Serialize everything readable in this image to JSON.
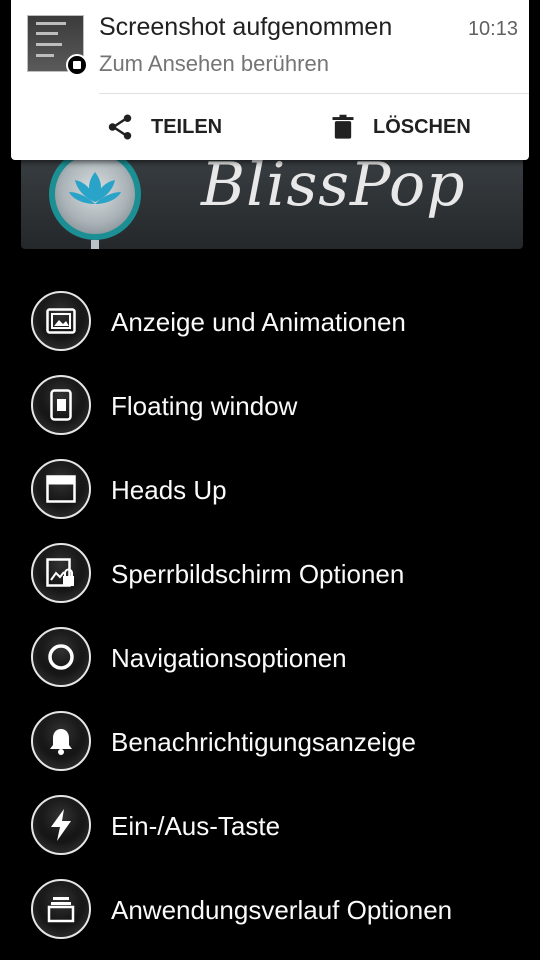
{
  "banner": {
    "brand": "BlissPop"
  },
  "notification": {
    "title": "Screenshot aufgenommen",
    "time": "10:13",
    "subtitle": "Zum Ansehen berühren",
    "actions": {
      "share": "TEILEN",
      "delete": "LÖSCHEN"
    }
  },
  "menu": {
    "items": [
      {
        "label": "Anzeige und Animationen",
        "icon": "display-animation-icon"
      },
      {
        "label": "Floating window",
        "icon": "floating-window-icon"
      },
      {
        "label": "Heads Up",
        "icon": "heads-up-icon"
      },
      {
        "label": "Sperrbildschirm Optionen",
        "icon": "lockscreen-icon"
      },
      {
        "label": "Navigationsoptionen",
        "icon": "navigation-circle-icon"
      },
      {
        "label": "Benachrichtigungsanzeige",
        "icon": "bell-icon"
      },
      {
        "label": "Ein-/Aus-Taste",
        "icon": "power-bolt-icon"
      },
      {
        "label": "Anwendungsverlauf Optionen",
        "icon": "recents-icon"
      }
    ]
  },
  "colors": {
    "accent": "#1b8f94",
    "background": "#000000",
    "notification_bg": "#ffffff"
  }
}
